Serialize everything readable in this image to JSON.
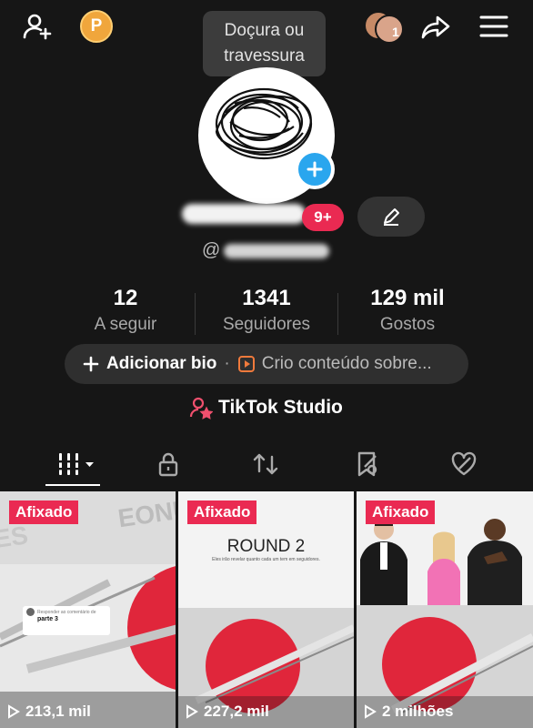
{
  "header": {
    "coin_letter": "P",
    "tooltip": "Doçura ou travessura",
    "friends_count": "1"
  },
  "profile": {
    "badge": "9+",
    "handle_prefix": "@"
  },
  "stats": [
    {
      "value": "12",
      "label": "A seguir"
    },
    {
      "value": "1341",
      "label": "Seguidores"
    },
    {
      "value": "129 mil",
      "label": "Gostos"
    }
  ],
  "bio": {
    "add_label": "Adicionar bio",
    "separator": "·",
    "content_text": "Crio conteúdo sobre..."
  },
  "studio": {
    "label": "TikTok Studio"
  },
  "tabs": [
    "grid-icon",
    "lock-icon",
    "repost-icon",
    "saved-icon",
    "liked-icon"
  ],
  "videos": [
    {
      "pinned": "Afixado",
      "views": "213,1 mil",
      "overlay_title": "parte 3",
      "overlay_sub": "Responder ao comentário de"
    },
    {
      "pinned": "Afixado",
      "views": "227,2 mil",
      "overlay_title": "ROUND 2",
      "overlay_sub": "Eles irão revelar quanto cada um tem em seguidores."
    },
    {
      "pinned": "Afixado",
      "views": "2 milhões"
    }
  ],
  "colors": {
    "background": "#161616",
    "accent": "#ea2a52",
    "blue": "#2aa6ee",
    "coin": "#f0a63c"
  }
}
